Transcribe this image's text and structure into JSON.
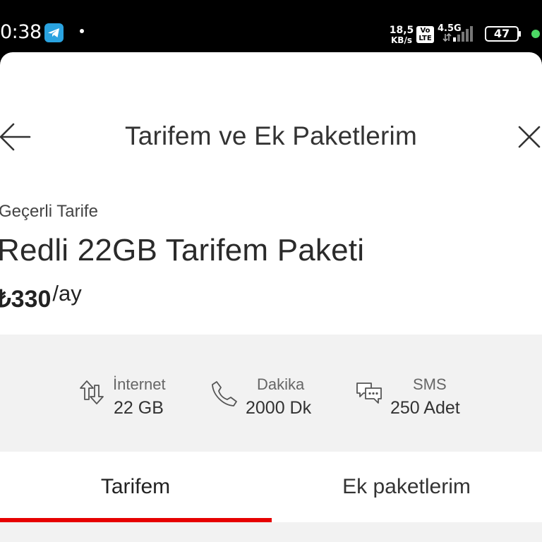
{
  "status_bar": {
    "time": "0:38",
    "notification_app": "telegram",
    "net_speed_value": "18,5",
    "net_speed_unit": "KB/s",
    "volte_top": "Vo",
    "volte_bottom": "LTE",
    "network_type": "4.5G",
    "battery_level": "47"
  },
  "header": {
    "title": "Tarifem ve Ek Paketlerim",
    "back_icon": "arrow-left-icon",
    "close_icon": "close-icon"
  },
  "tariff": {
    "caption": "Geçerli Tarife",
    "name": "Redli 22GB Tarifem Paketi",
    "price": "₺330",
    "period": "/ay"
  },
  "features": [
    {
      "label": "İnternet",
      "value": "22 GB",
      "icon": "data-transfer-icon"
    },
    {
      "label": "Dakika",
      "value": "2000 Dk",
      "icon": "phone-icon"
    },
    {
      "label": "SMS",
      "value": "250 Adet",
      "icon": "chat-bubbles-icon"
    }
  ],
  "tabs": [
    {
      "label": "Tarifem",
      "active": true
    },
    {
      "label": "Ek paketlerim",
      "active": false
    }
  ],
  "colors": {
    "accent": "#e60000",
    "feature_bg": "#f2f2f2",
    "text_dark": "#333333"
  }
}
